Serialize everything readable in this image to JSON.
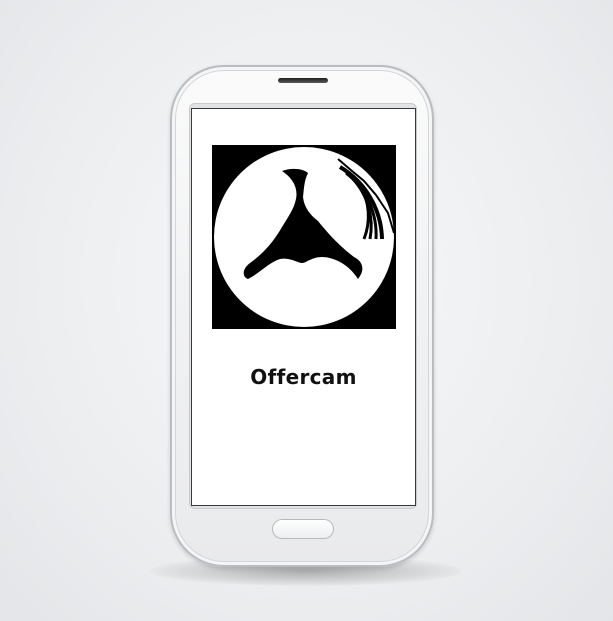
{
  "app": {
    "name": "Offercam",
    "logo_icon": "offercam-logo-icon"
  },
  "colors": {
    "background": "#eceef0",
    "phone_body": "#f1f2f3",
    "screen": "#ffffff",
    "logo_bg": "#000000",
    "logo_fg": "#ffffff",
    "text": "#111111"
  }
}
